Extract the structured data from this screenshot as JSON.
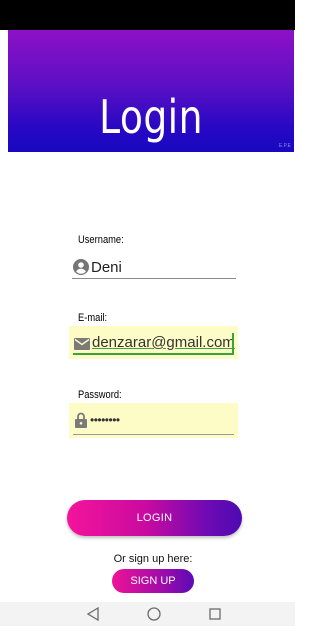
{
  "header": {
    "title": "Login",
    "corner_mark": "E.P.E"
  },
  "username": {
    "label": "Username:",
    "value": "Deni",
    "icon": "person-circle-icon"
  },
  "email": {
    "label": "E-mail:",
    "value": "denzarar@gmail.com",
    "icon": "envelope-icon"
  },
  "password": {
    "label": "Password:",
    "value": "••••••••",
    "icon": "lock-icon"
  },
  "login_button": {
    "label": "LOGIN"
  },
  "signup": {
    "prompt": "Or sign up here:",
    "button_label": "SIGN UP"
  },
  "nav": {
    "back": "back-triangle-icon",
    "home": "home-circle-icon",
    "recents": "recents-square-icon"
  },
  "colors": {
    "header_top": "#8e10c6",
    "header_bottom": "#1808c0",
    "button_start": "#f4149a",
    "button_end": "#4e0ab2",
    "field_highlight": "#fdfcc6",
    "focus_underline": "#3ca33c"
  }
}
